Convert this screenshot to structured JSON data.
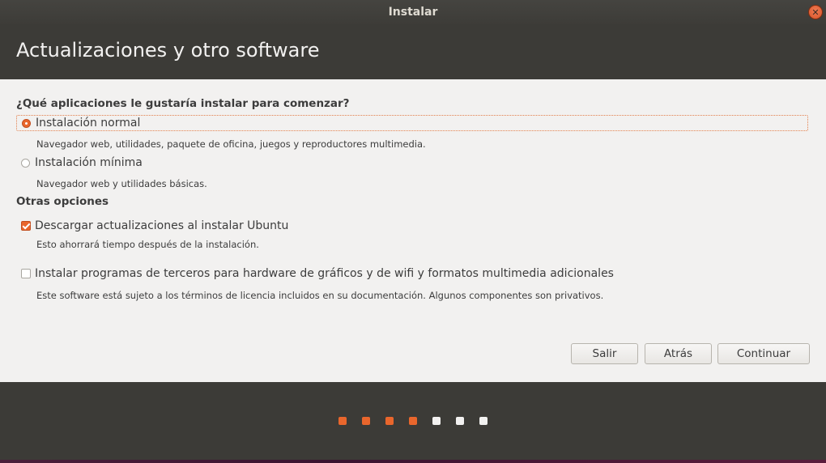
{
  "window": {
    "title": "Instalar",
    "close_icon": "close-icon"
  },
  "header": {
    "title": "Actualizaciones y otro software"
  },
  "question": "¿Qué aplicaciones le gustaría instalar para comenzar?",
  "install_options": [
    {
      "label": "Instalación normal",
      "description": "Navegador web, utilidades, paquete de oficina, juegos y reproductores multimedia.",
      "selected": true
    },
    {
      "label": "Instalación mínima",
      "description": "Navegador web y utilidades básicas.",
      "selected": false
    }
  ],
  "other_options": {
    "title": "Otras opciones",
    "items": [
      {
        "label": "Descargar actualizaciones al instalar Ubuntu",
        "description": "Esto ahorrará tiempo después de la instalación.",
        "checked": true
      },
      {
        "label": "Instalar programas de terceros para hardware de gráficos y de wifi y formatos multimedia adicionales",
        "description": "Este software está sujeto a los términos de licencia incluidos en su documentación. Algunos componentes son privativos.",
        "checked": false
      }
    ]
  },
  "buttons": {
    "quit": "Salir",
    "back": "Atrás",
    "continue": "Continuar"
  },
  "progress": {
    "total_steps": 7,
    "completed_steps": 4
  },
  "colors": {
    "accent": "#e9662c",
    "header_bg": "#3c3b37",
    "content_bg": "#f2f1f0"
  }
}
